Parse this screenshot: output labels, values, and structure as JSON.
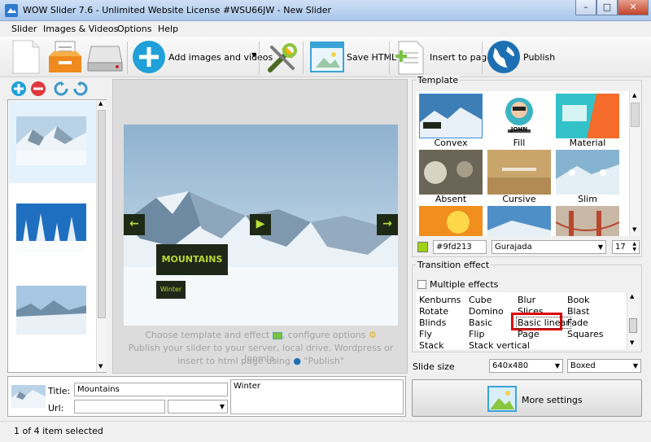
{
  "window": {
    "title": "WOW Slider 7.6 - Unlimited Website License #WSU66JW - New Slider"
  },
  "menu": [
    "Slider",
    "Images & Videos",
    "Options",
    "Help"
  ],
  "toolbar": {
    "add_label": "Add images and videos",
    "save_html_label": "Save HTML",
    "insert_label": "Insert to page",
    "publish_label": "Publish"
  },
  "preview": {
    "caption_title": "MOUNTAINS",
    "caption_sub": "Winter",
    "hint_line1": "Choose template and effect",
    "hint_line1b": ", configure options",
    "hint_line2": "Publish your slider to your server, local drive, Wordpress or Joomla,",
    "hint_line3": "insert to html page using",
    "hint_line3b": "\"Publish\""
  },
  "template": {
    "group_label": "Template",
    "names": [
      "Convex",
      "Fill",
      "Material",
      "Absent",
      "Cursive",
      "Slim"
    ],
    "fill_label": "JOHN",
    "color_value": "#9fd213",
    "color_swatch": "#9fd213",
    "font_value": "Gurajada",
    "size_value": "17"
  },
  "transition": {
    "group_label": "Transition effect",
    "multiple_label": "Multiple effects",
    "col1": [
      "Kenburns",
      "Rotate",
      "Blinds",
      "Fly",
      "Stack"
    ],
    "col2": [
      "Cube",
      "Domino",
      "Basic",
      "Flip",
      "Stack vertical"
    ],
    "col3": [
      "Blur",
      "Slices",
      "Basic linear",
      "Page"
    ],
    "col4": [
      "Book",
      "Blast",
      "Fade",
      "Squares"
    ]
  },
  "slide_size": {
    "label": "Slide size",
    "size_value": "640x480",
    "mode_value": "Boxed"
  },
  "item": {
    "title_label": "Title:",
    "title_value": "Mountains",
    "url_label": "Url:",
    "description": "Winter"
  },
  "more_settings_label": "More settings",
  "status": "1 of 4 item selected"
}
